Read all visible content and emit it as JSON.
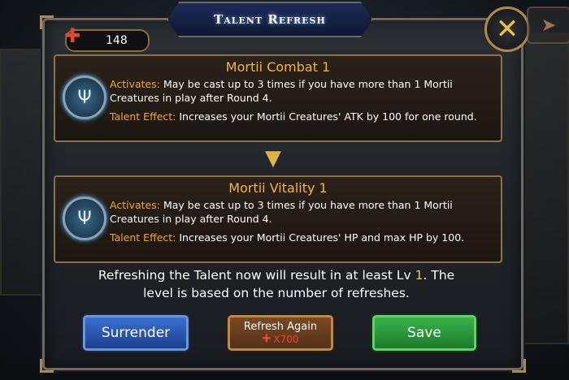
{
  "title": "Talent Refresh",
  "currency": {
    "value": "148",
    "icon": "medal-icon"
  },
  "cards": [
    {
      "name": "Mortii Combat 1",
      "activates_label": "Activates:",
      "activates_text": "May be cast up to 3 times if you have more than 1 Mortii Creatures in play after Round 4.",
      "effect_label": "Talent Effect:",
      "effect_text": "Increases your Mortii Creatures' ATK by 100 for one round."
    },
    {
      "name": "Mortii Vitality 1",
      "activates_label": "Activates:",
      "activates_text": "May be cast up to 3 times if you have more than 1 Mortii Creatures in play after Round 4.",
      "effect_label": "Talent Effect:",
      "effect_text": "Increases your Mortii Creatures' HP and max HP by 100."
    }
  ],
  "info": {
    "line1_prefix": "Refreshing the Talent now will result in at least Lv",
    "level": "1",
    "line1_suffix": ". The",
    "line2": "level is based on the number of refreshes."
  },
  "buttons": {
    "surrender": "Surrender",
    "refresh": "Refresh Again",
    "refresh_cost": "X700",
    "save": "Save"
  },
  "colors": {
    "accent_orange": "#f5a623",
    "title_gold": "#f4b43a",
    "surrender_blue": "#2a57b0",
    "save_green": "#2a9a3a",
    "cost_red": "#ff3a2a"
  }
}
